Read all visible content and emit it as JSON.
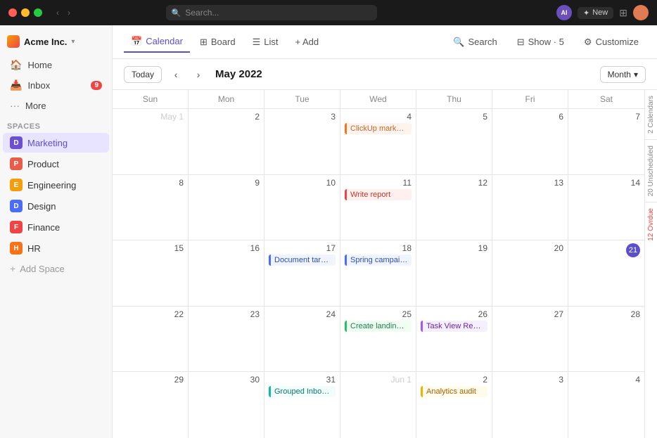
{
  "titlebar": {
    "search_placeholder": "Search...",
    "ai_label": "AI",
    "new_label": "New"
  },
  "sidebar": {
    "workspace": "Acme Inc.",
    "nav": [
      {
        "label": "Home",
        "icon": "🏠",
        "badge": null
      },
      {
        "label": "Inbox",
        "icon": "📥",
        "badge": "9"
      },
      {
        "label": "More",
        "icon": "···",
        "badge": null
      }
    ],
    "spaces_label": "Spaces",
    "spaces": [
      {
        "label": "Marketing",
        "color": "#6b4fce",
        "initial": "D",
        "active": true
      },
      {
        "label": "Product",
        "color": "#e85d4a",
        "initial": "P",
        "active": false
      },
      {
        "label": "Engineering",
        "color": "#f59e0b",
        "initial": "E",
        "active": false
      },
      {
        "label": "Design",
        "color": "#4b6cf7",
        "initial": "D",
        "active": false
      },
      {
        "label": "Finance",
        "color": "#ef4444",
        "initial": "F",
        "active": false
      },
      {
        "label": "HR",
        "color": "#f97316",
        "initial": "H",
        "active": false
      }
    ],
    "add_space": "Add Space"
  },
  "topbar": {
    "views": [
      {
        "label": "Calendar",
        "icon": "📅",
        "active": true
      },
      {
        "label": "Board",
        "icon": "⊞",
        "active": false
      },
      {
        "label": "List",
        "icon": "☰",
        "active": false
      }
    ],
    "add_label": "+ Add",
    "search_label": "Search",
    "show_label": "Show · 5",
    "customize_label": "Customize"
  },
  "calendar": {
    "today_label": "Today",
    "title": "May 2022",
    "month_label": "Month",
    "days": [
      "Sun",
      "Mon",
      "Tue",
      "Wed",
      "Thu",
      "Fri",
      "Sat"
    ],
    "rows": [
      [
        {
          "num": "May 1",
          "other": true
        },
        {
          "num": "2"
        },
        {
          "num": "3"
        },
        {
          "num": "4",
          "events": [
            {
              "label": "ClickUp marketing plan",
              "type": "orange"
            }
          ]
        },
        {
          "num": "5"
        },
        {
          "num": "6"
        },
        {
          "num": "7"
        }
      ],
      [
        {
          "num": "8"
        },
        {
          "num": "9"
        },
        {
          "num": "10"
        },
        {
          "num": "11",
          "events": [
            {
              "label": "Write report",
              "type": "red"
            }
          ]
        },
        {
          "num": "12"
        },
        {
          "num": "13"
        },
        {
          "num": "14"
        }
      ],
      [
        {
          "num": "15"
        },
        {
          "num": "16"
        },
        {
          "num": "17",
          "events": [
            {
              "label": "Document target users",
              "type": "blue"
            }
          ]
        },
        {
          "num": "18",
          "events": [
            {
              "label": "Spring campaign image assets",
              "type": "blue"
            }
          ]
        },
        {
          "num": "19"
        },
        {
          "num": "20"
        },
        {
          "num": "21",
          "today": true
        }
      ],
      [
        {
          "num": "22"
        },
        {
          "num": "23"
        },
        {
          "num": "24"
        },
        {
          "num": "25",
          "events": [
            {
              "label": "Create landing page",
              "type": "green"
            }
          ]
        },
        {
          "num": "26",
          "events": [
            {
              "label": "Task View Redesign",
              "type": "purple"
            }
          ]
        },
        {
          "num": "27"
        },
        {
          "num": "28"
        }
      ],
      [
        {
          "num": "29"
        },
        {
          "num": "30"
        },
        {
          "num": "31",
          "events": [
            {
              "label": "Grouped Inbox Comments",
              "type": "teal"
            }
          ]
        },
        {
          "num": "Jun 1",
          "other": true
        },
        {
          "num": "2",
          "events": [
            {
              "label": "Analytics audit",
              "type": "yellow"
            }
          ]
        },
        {
          "num": "3"
        },
        {
          "num": "4"
        }
      ]
    ]
  },
  "side_panel": {
    "calendars_label": "2 Calendars",
    "unscheduled_label": "20 Unscheduled",
    "overdue_label": "12 Ovrdue"
  }
}
